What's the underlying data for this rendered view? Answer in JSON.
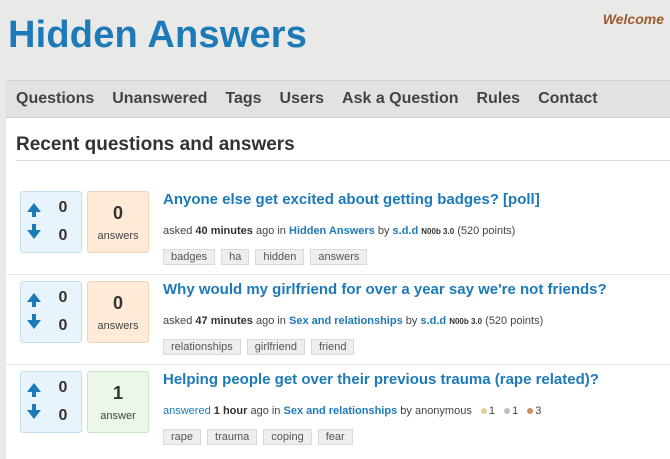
{
  "header": {
    "site_title": "Hidden Answers",
    "welcome": "Welcome"
  },
  "nav": [
    "Questions",
    "Unanswered",
    "Tags",
    "Users",
    "Ask a Question",
    "Rules",
    "Contact"
  ],
  "page_title": "Recent questions and answers",
  "questions": [
    {
      "up": "0",
      "down": "0",
      "answers": "0",
      "answers_label": "answers",
      "title": "Anyone else get excited about getting badges? [poll]",
      "action": "asked",
      "time": "40 minutes",
      "ago": "ago in",
      "category": "Hidden Answers",
      "by": "by",
      "user": "s.d.d",
      "user_title": "N00b 3.0",
      "points": "(520 points)",
      "tags": [
        "badges",
        "ha",
        "hidden",
        "answers"
      ]
    },
    {
      "up": "0",
      "down": "0",
      "answers": "0",
      "answers_label": "answers",
      "title": "Why would my girlfriend for over a year say we're not friends?",
      "action": "asked",
      "time": "47 minutes",
      "ago": "ago in",
      "category": "Sex and relationships",
      "by": "by",
      "user": "s.d.d",
      "user_title": "N00b 3.0",
      "points": "(520 points)",
      "tags": [
        "relationships",
        "girlfriend",
        "friend"
      ]
    },
    {
      "up": "0",
      "down": "0",
      "answers": "1",
      "answers_label": "answer",
      "title": "Helping people get over their previous trauma (rape related)?",
      "action": "answered",
      "time": "1 hour",
      "ago": "ago in",
      "category": "Sex and relationships",
      "by": "by",
      "user": "anonymous",
      "badges": [
        {
          "count": "1",
          "color": "#e8c9a0"
        },
        {
          "count": "1",
          "color": "#c0c0c0"
        },
        {
          "count": "3",
          "color": "#cd8f5a"
        }
      ],
      "tags": [
        "rape",
        "trauma",
        "coping",
        "fear"
      ]
    }
  ]
}
